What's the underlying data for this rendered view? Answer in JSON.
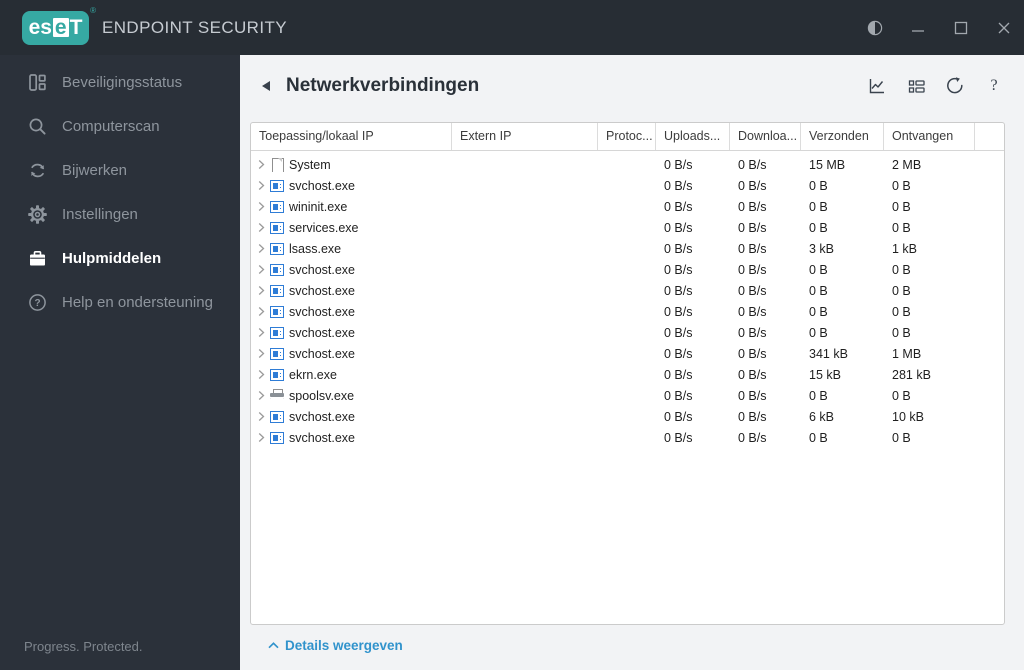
{
  "window": {
    "brand": {
      "logo_left": "es",
      "logo_boxed": "e",
      "logo_right": "T",
      "registered": "®",
      "title": "ENDPOINT SECURITY"
    },
    "controls": [
      {
        "name": "contrast-toggle",
        "icon": "half-circle-icon"
      },
      {
        "name": "minimize",
        "icon": "minimize-icon"
      },
      {
        "name": "maximize",
        "icon": "maximize-icon"
      },
      {
        "name": "close",
        "icon": "close-icon"
      }
    ]
  },
  "sidebar": {
    "items": [
      {
        "label": "Beveiligingsstatus",
        "icon": "dashboard-icon",
        "active": false
      },
      {
        "label": "Computerscan",
        "icon": "search-icon",
        "active": false
      },
      {
        "label": "Bijwerken",
        "icon": "sync-icon",
        "active": false
      },
      {
        "label": "Instellingen",
        "icon": "gear-icon",
        "active": false
      },
      {
        "label": "Hulpmiddelen",
        "icon": "toolbox-icon",
        "active": true
      },
      {
        "label": "Help en ondersteuning",
        "icon": "help-circle-icon",
        "active": false
      }
    ],
    "footer": "Progress. Protected."
  },
  "page": {
    "title": "Netwerkverbindingen",
    "toolbar_icons": [
      "line-chart-icon",
      "details-grid-icon",
      "refresh-icon",
      "help-icon"
    ],
    "details_toggle": "Details weergeven"
  },
  "table": {
    "columns": [
      "Toepassing/lokaal IP",
      "Extern IP",
      "Protoc...",
      "Uploads...",
      "Downloa...",
      "Verzonden",
      "Ontvangen",
      ""
    ],
    "rows": [
      {
        "name": "System",
        "icon": "file-icon",
        "extern_ip": "",
        "protocol": "",
        "upload": "0 B/s",
        "download": "0 B/s",
        "sent": "15 MB",
        "received": "2 MB"
      },
      {
        "name": "svchost.exe",
        "icon": "app-window-icon",
        "extern_ip": "",
        "protocol": "",
        "upload": "0 B/s",
        "download": "0 B/s",
        "sent": "0 B",
        "received": "0 B"
      },
      {
        "name": "wininit.exe",
        "icon": "app-window-icon",
        "extern_ip": "",
        "protocol": "",
        "upload": "0 B/s",
        "download": "0 B/s",
        "sent": "0 B",
        "received": "0 B"
      },
      {
        "name": "services.exe",
        "icon": "app-window-icon",
        "extern_ip": "",
        "protocol": "",
        "upload": "0 B/s",
        "download": "0 B/s",
        "sent": "0 B",
        "received": "0 B"
      },
      {
        "name": "lsass.exe",
        "icon": "app-window-icon",
        "extern_ip": "",
        "protocol": "",
        "upload": "0 B/s",
        "download": "0 B/s",
        "sent": "3 kB",
        "received": "1 kB"
      },
      {
        "name": "svchost.exe",
        "icon": "app-window-icon",
        "extern_ip": "",
        "protocol": "",
        "upload": "0 B/s",
        "download": "0 B/s",
        "sent": "0 B",
        "received": "0 B"
      },
      {
        "name": "svchost.exe",
        "icon": "app-window-icon",
        "extern_ip": "",
        "protocol": "",
        "upload": "0 B/s",
        "download": "0 B/s",
        "sent": "0 B",
        "received": "0 B"
      },
      {
        "name": "svchost.exe",
        "icon": "app-window-icon",
        "extern_ip": "",
        "protocol": "",
        "upload": "0 B/s",
        "download": "0 B/s",
        "sent": "0 B",
        "received": "0 B"
      },
      {
        "name": "svchost.exe",
        "icon": "app-window-icon",
        "extern_ip": "",
        "protocol": "",
        "upload": "0 B/s",
        "download": "0 B/s",
        "sent": "0 B",
        "received": "0 B"
      },
      {
        "name": "svchost.exe",
        "icon": "app-window-icon",
        "extern_ip": "",
        "protocol": "",
        "upload": "0 B/s",
        "download": "0 B/s",
        "sent": "341 kB",
        "received": "1 MB"
      },
      {
        "name": "ekrn.exe",
        "icon": "app-window-icon",
        "extern_ip": "",
        "protocol": "",
        "upload": "0 B/s",
        "download": "0 B/s",
        "sent": "15 kB",
        "received": "281 kB"
      },
      {
        "name": "spoolsv.exe",
        "icon": "printer-icon",
        "extern_ip": "",
        "protocol": "",
        "upload": "0 B/s",
        "download": "0 B/s",
        "sent": "0 B",
        "received": "0 B"
      },
      {
        "name": "svchost.exe",
        "icon": "app-window-icon",
        "extern_ip": "",
        "protocol": "",
        "upload": "0 B/s",
        "download": "0 B/s",
        "sent": "6 kB",
        "received": "10 kB"
      },
      {
        "name": "svchost.exe",
        "icon": "app-window-icon",
        "extern_ip": "",
        "protocol": "",
        "upload": "0 B/s",
        "download": "0 B/s",
        "sent": "0 B",
        "received": "0 B"
      }
    ]
  },
  "colors": {
    "brand_teal": "#36A9A3",
    "link_blue": "#3193CC",
    "app_icon_blue": "#2E7CD6",
    "topbar_bg": "#272D34",
    "sidebar_bg": "#2B313A"
  }
}
